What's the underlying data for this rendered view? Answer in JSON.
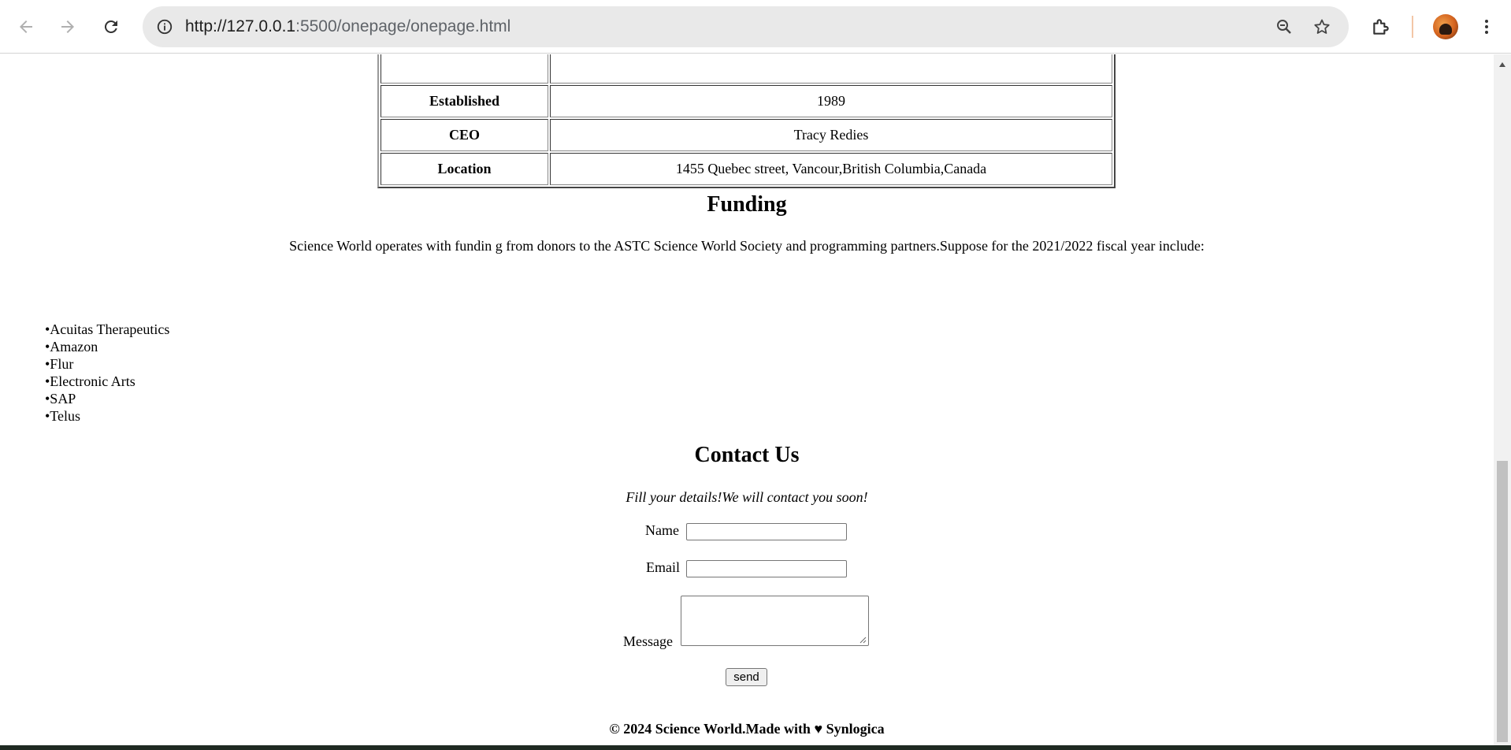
{
  "browser": {
    "url_scheme_host": "http://127.0.0.1",
    "url_rest": ":5500/onepage/onepage.html",
    "icons": [
      "back-arrow-icon",
      "forward-arrow-icon",
      "reload-icon",
      "site-info-icon",
      "zoom-icon",
      "star-icon",
      "extensions-icon",
      "menu-dots-icon"
    ]
  },
  "info_table": {
    "rows": [
      {
        "key": "Established",
        "value": "1989"
      },
      {
        "key": "CEO",
        "value": "Tracy Redies"
      },
      {
        "key": "Location",
        "value": "1455 Quebec street, Vancour,British Columbia,Canada"
      }
    ]
  },
  "funding": {
    "heading": "Funding",
    "text": "Science World operates with fundin g from donors to the ASTC Science World Society and programming partners.Suppose for the 2021/2022 fiscal year include:",
    "sponsors": [
      "•Acuitas Therapeutics",
      "•Amazon",
      "•Flur",
      "•Electronic Arts",
      "•SAP",
      "•Telus"
    ]
  },
  "contact": {
    "heading": "Contact Us",
    "subtitle": "Fill your details!We will contact you soon!",
    "name_label": "Name",
    "name_value": "",
    "email_label": "Email",
    "email_value": "",
    "message_label": "Message",
    "message_value": "",
    "send_label": "send"
  },
  "footer": {
    "text": "© 2024 Science World.Made with ♥ Synlogica"
  }
}
